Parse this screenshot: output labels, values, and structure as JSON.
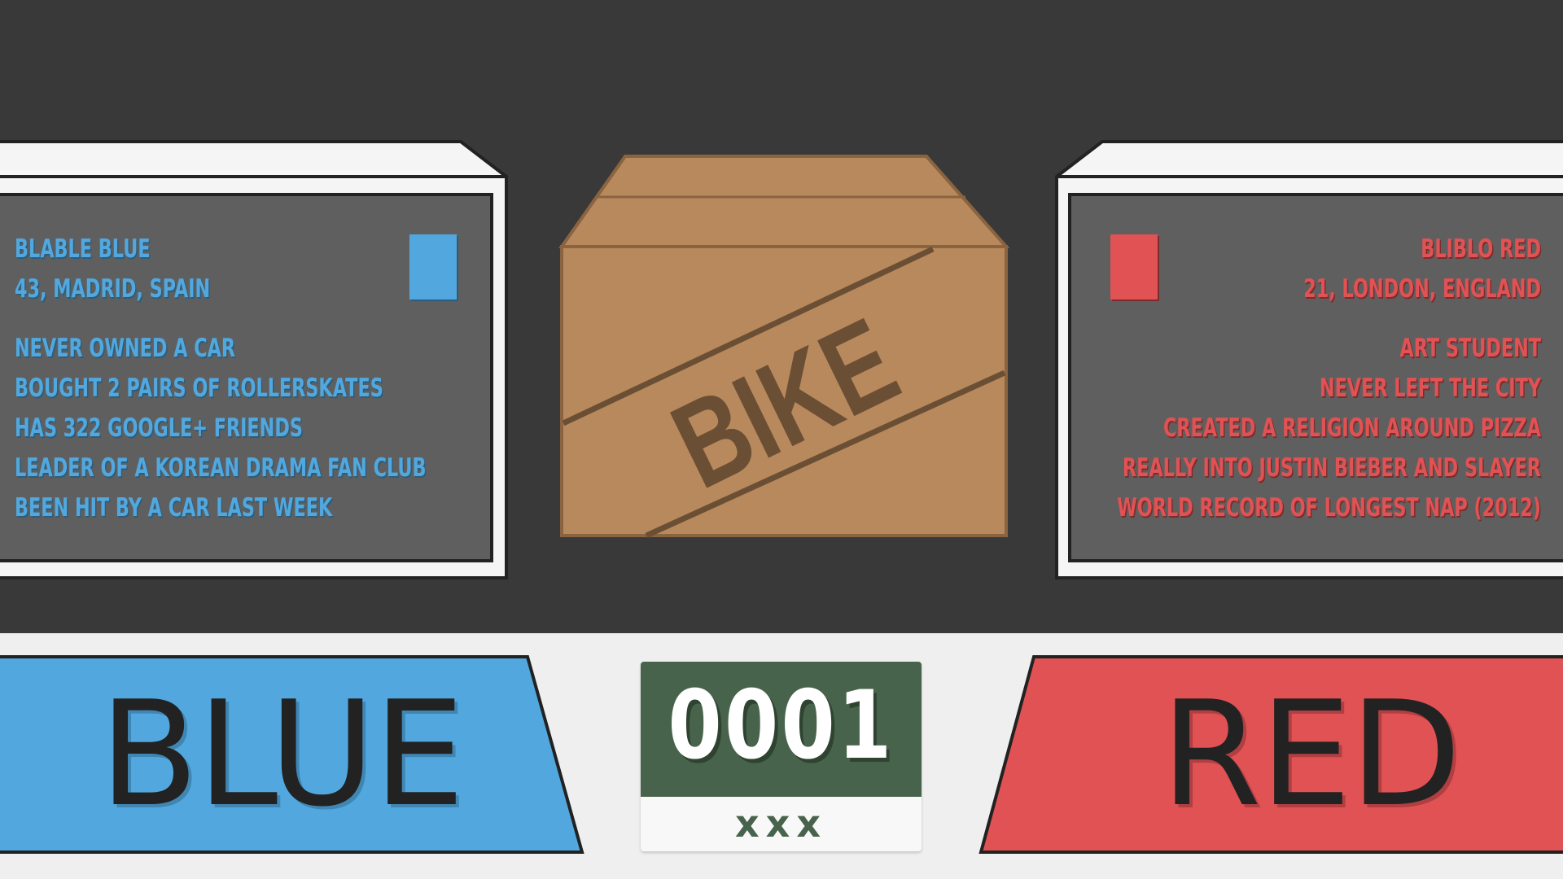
{
  "left_profile": {
    "name": "Blable Blue",
    "details": "43, Madrid, Spain",
    "facts": [
      "Never owned a car",
      "Bought 2 pairs of rollerskates",
      "Has 322 Google+ friends",
      "Leader of a Korean drama fan club",
      "Been hit by a car last week"
    ],
    "color": "#52a8de"
  },
  "right_profile": {
    "name": "Bliblo Red",
    "details": "21, London, England",
    "facts": [
      "Art student",
      "Never left the city",
      "Created a religion around pizza",
      "Really into Justin Bieber and Slayer",
      "World record of longest nap (2012)"
    ],
    "color": "#e05254"
  },
  "box": {
    "label": "BIKE",
    "color": "#b8895c"
  },
  "teams": {
    "left": {
      "label": "BLUE",
      "color": "#52a8de"
    },
    "right": {
      "label": "RED",
      "color": "#e05254"
    }
  },
  "counter": {
    "number": "0001",
    "sub": "xxx",
    "color": "#48634b"
  }
}
